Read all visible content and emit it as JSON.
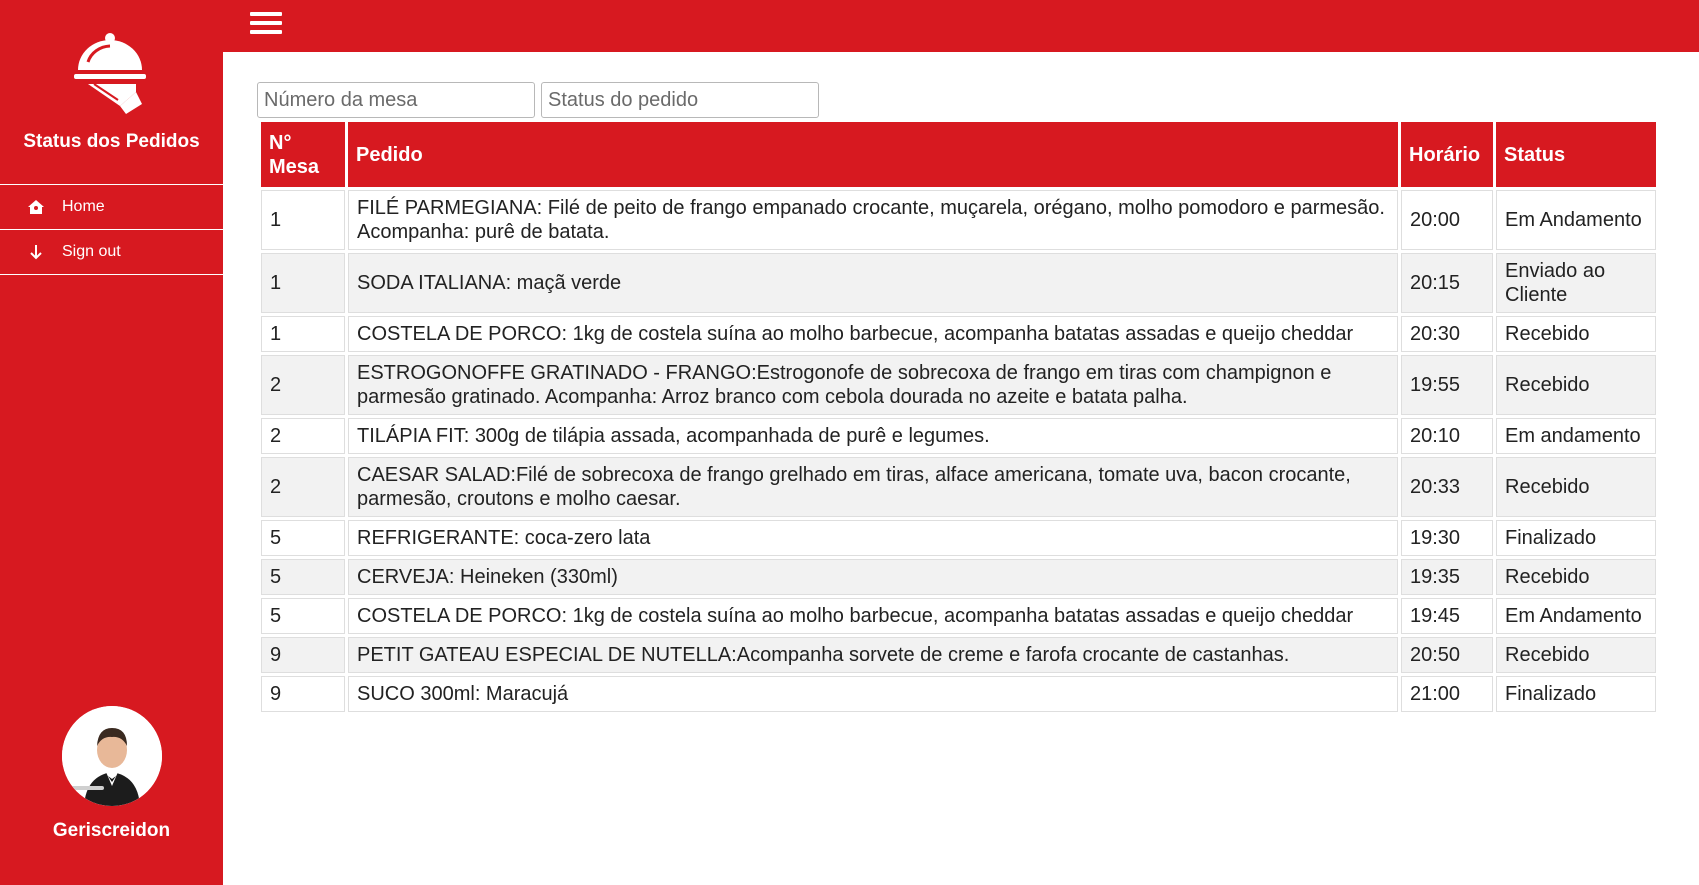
{
  "sidebar": {
    "title": "Status dos Pedidos",
    "nav": [
      {
        "label": "Home",
        "icon": "home-icon"
      },
      {
        "label": "Sign out",
        "icon": "arrow-down-icon"
      }
    ],
    "user_name": "Geriscreidon"
  },
  "filters": {
    "table_placeholder": "Número da mesa",
    "status_placeholder": "Status do pedido"
  },
  "table": {
    "headers": [
      "N° Mesa",
      "Pedido",
      "Horário",
      "Status"
    ],
    "rows": [
      {
        "mesa": "1",
        "pedido": "FILÉ PARMEGIANA: Filé de peito de frango empanado crocante, muçarela, orégano, molho pomodoro e parmesão. Acompanha: purê de batata.",
        "horario": "20:00",
        "status": "Em Andamento"
      },
      {
        "mesa": "1",
        "pedido": "SODA ITALIANA: maçã verde",
        "horario": "20:15",
        "status": "Enviado ao Cliente"
      },
      {
        "mesa": "1",
        "pedido": "COSTELA DE PORCO: 1kg de costela suína ao molho barbecue, acompanha batatas assadas e queijo cheddar",
        "horario": "20:30",
        "status": "Recebido"
      },
      {
        "mesa": "2",
        "pedido": "ESTROGONOFFE GRATINADO - FRANGO:Estrogonofe de sobrecoxa de frango em tiras com champignon e parmesão gratinado. Acompanha: Arroz branco com cebola dourada no azeite e batata palha.",
        "horario": "19:55",
        "status": "Recebido"
      },
      {
        "mesa": "2",
        "pedido": "TILÁPIA FIT: 300g de tilápia assada, acompanhada de purê e legumes.",
        "horario": "20:10",
        "status": "Em andamento"
      },
      {
        "mesa": "2",
        "pedido": "CAESAR SALAD:Filé de sobrecoxa de frango grelhado em tiras, alface americana, tomate uva, bacon crocante, parmesão, croutons e molho caesar.",
        "horario": "20:33",
        "status": "Recebido"
      },
      {
        "mesa": "5",
        "pedido": "REFRIGERANTE: coca-zero lata",
        "horario": "19:30",
        "status": "Finalizado"
      },
      {
        "mesa": "5",
        "pedido": "CERVEJA: Heineken (330ml)",
        "horario": "19:35",
        "status": "Recebido"
      },
      {
        "mesa": "5",
        "pedido": "COSTELA DE PORCO: 1kg de costela suína ao molho barbecue, acompanha batatas assadas e queijo cheddar",
        "horario": "19:45",
        "status": "Em Andamento"
      },
      {
        "mesa": "9",
        "pedido": "PETIT GATEAU ESPECIAL DE NUTELLA:Acompanha sorvete de creme e farofa crocante de castanhas.",
        "horario": "20:50",
        "status": "Recebido"
      },
      {
        "mesa": "9",
        "pedido": "SUCO 300ml: Maracujá",
        "horario": "21:00",
        "status": "Finalizado"
      }
    ]
  },
  "colors": {
    "brand_red": "#d71920",
    "row_alt": "#f2f2f2"
  }
}
